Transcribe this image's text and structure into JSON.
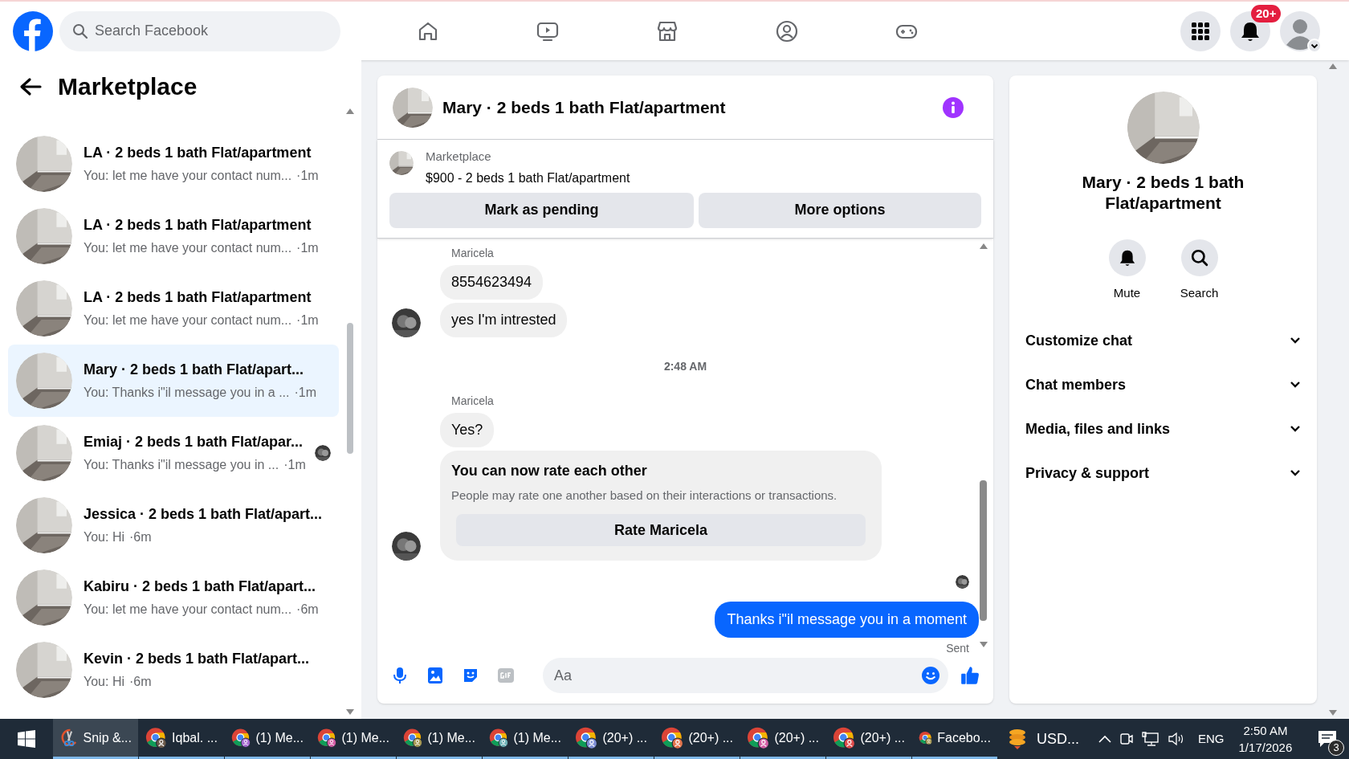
{
  "topbar": {
    "search": {
      "placeholder": "Search Facebook"
    },
    "notification_badge": "20+"
  },
  "sidebar": {
    "title": "Marketplace",
    "conversations": [
      {
        "title": "LA · 2 beds 1 bath Flat/apartment",
        "preview": "You: let me have your contact num...",
        "time": "·1m",
        "selected": false,
        "read_receipt": false
      },
      {
        "title": "LA · 2 beds 1 bath Flat/apartment",
        "preview": "You: let me have your contact num...",
        "time": "·1m",
        "selected": false,
        "read_receipt": false
      },
      {
        "title": "LA · 2 beds 1 bath Flat/apartment",
        "preview": "You: let me have your contact num...",
        "time": "·1m",
        "selected": false,
        "read_receipt": false
      },
      {
        "title": "Mary · 2 beds 1 bath Flat/apart...",
        "preview": "You: Thanks i\"il message you in a ...",
        "time": "·1m",
        "selected": true,
        "read_receipt": false
      },
      {
        "title": "Emiaj · 2 beds 1 bath Flat/apar...",
        "preview": "You: Thanks i\"il message you in ...",
        "time": "·1m",
        "selected": false,
        "read_receipt": true
      },
      {
        "title": "Jessica · 2 beds 1 bath Flat/apart...",
        "preview": "You: Hi",
        "time": "·6m",
        "selected": false,
        "read_receipt": false
      },
      {
        "title": "Kabiru · 2 beds 1 bath Flat/apart...",
        "preview": "You: let me have your contact num...",
        "time": "·6m",
        "selected": false,
        "read_receipt": false
      },
      {
        "title": "Kevin · 2 beds 1 bath Flat/apart...",
        "preview": "You: Hi",
        "time": "·6m",
        "selected": false,
        "read_receipt": false
      }
    ]
  },
  "chat": {
    "title": "Mary · 2 beds 1 bath Flat/apartment",
    "listing": {
      "label": "Marketplace",
      "text": "$900 - 2 beds 1 bath Flat/apartment"
    },
    "actions": [
      "Mark as pending",
      "More options"
    ],
    "messages": [
      {
        "kind": "incoming",
        "sender": "Maricela",
        "bubbles": [
          "8554623494",
          "yes I'm intrested"
        ]
      },
      {
        "kind": "timestamp",
        "text": "2:48 AM"
      },
      {
        "kind": "incoming",
        "sender": "Maricela",
        "bubbles": [
          "Yes?"
        ],
        "card": {
          "title": "You can now rate each other",
          "text": "People may rate one another based on their interactions or transactions.",
          "button": "Rate Maricela"
        }
      },
      {
        "kind": "outgoing",
        "text": "Thanks i\"il message you in a moment",
        "status": "Sent"
      }
    ],
    "composer": {
      "placeholder": "Aa"
    }
  },
  "details": {
    "title": "Mary · 2 beds 1 bath Flat/apartment",
    "actions": [
      {
        "kind": "mute",
        "label": "Mute"
      },
      {
        "kind": "search",
        "label": "Search"
      }
    ],
    "sections": [
      {
        "label": "Customize chat",
        "expanded": false
      },
      {
        "label": "Chat members",
        "expanded": false
      },
      {
        "label": "Media, files and links",
        "expanded": false
      },
      {
        "label": "Privacy & support",
        "expanded": false
      }
    ]
  },
  "taskbar": {
    "items": [
      {
        "kind": "snip",
        "label": "Snip &...",
        "selected": true
      },
      {
        "kind": "chrome",
        "label": "Iqbal. ...",
        "selected": false,
        "color": "#6b5a4a"
      },
      {
        "kind": "chrome",
        "label": "(1) Me...",
        "selected": false,
        "color": "#a86bd1"
      },
      {
        "kind": "chrome",
        "label": "(1) Me...",
        "selected": false,
        "color": "#d45fa6"
      },
      {
        "kind": "chrome",
        "label": "(1) Me...",
        "selected": false,
        "color": "#a89a55"
      },
      {
        "kind": "chrome",
        "label": "(1) Me...",
        "selected": false,
        "color": "#6fb3b8"
      },
      {
        "kind": "chrome",
        "label": "(20+) ...",
        "selected": false,
        "color": "#7f8fd6"
      },
      {
        "kind": "chrome",
        "label": "(20+) ...",
        "selected": false,
        "color": "#e3744c"
      },
      {
        "kind": "chrome",
        "label": "(20+) ...",
        "selected": false,
        "color": "#d45fa6"
      },
      {
        "kind": "chrome",
        "label": "(20+) ...",
        "selected": false,
        "color": "#e04c4c"
      },
      {
        "kind": "chrome",
        "label": "Facebo...",
        "selected": false,
        "color": "#a89a55"
      }
    ],
    "tray": {
      "app": "USD...",
      "language": "ENG",
      "time": "2:50 AM",
      "date": "1/17/2026",
      "notifications": "3"
    }
  }
}
